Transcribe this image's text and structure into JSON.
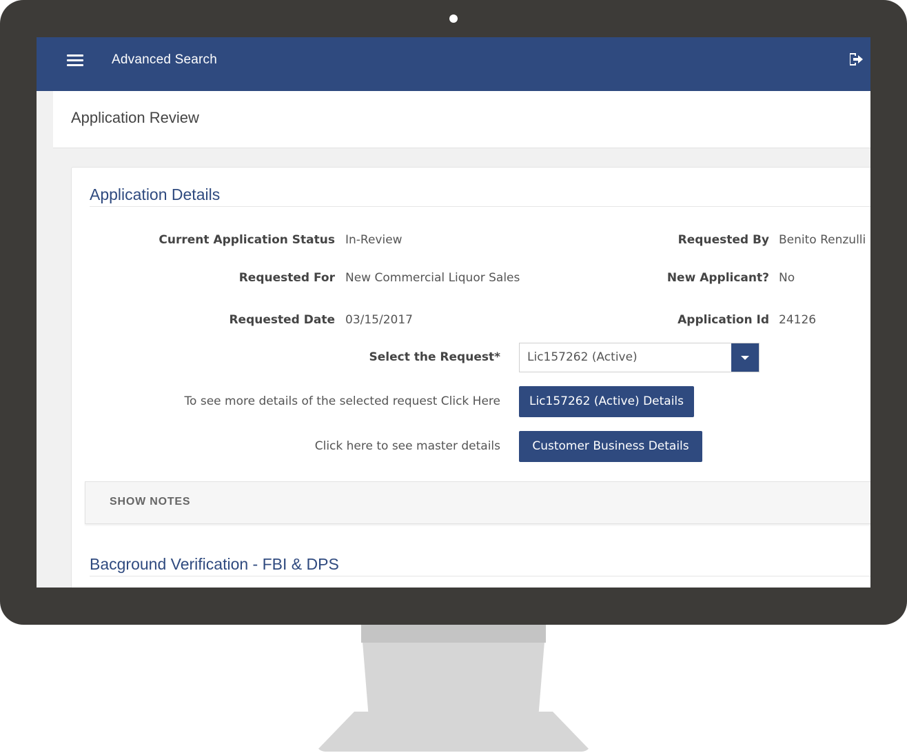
{
  "topbar": {
    "title": "Advanced Search",
    "menu_icon": "hamburger-menu-icon",
    "logout_icon": "logout-icon"
  },
  "page": {
    "title": "Application Review"
  },
  "details": {
    "section_title": "Application Details",
    "current_status_label": "Current Application Status",
    "current_status_value": "In-Review",
    "requested_for_label": "Requested For",
    "requested_for_value": "New Commercial Liquor Sales",
    "requested_date_label": "Requested Date",
    "requested_date_value": "03/15/2017",
    "requested_by_label": "Requested By",
    "requested_by_value": "Benito Renzulli",
    "new_applicant_label": "New Applicant?",
    "new_applicant_value": "No",
    "application_id_label": "Application Id",
    "application_id_value": "24126",
    "select_request_label": "Select the Request*",
    "select_request_value": "Lic157262 (Active)",
    "more_details_hint": "To see more details of the selected request Click Here",
    "more_details_button": "Lic157262 (Active) Details",
    "master_details_hint": "Click here to see master details",
    "master_details_button": "Customer Business Details"
  },
  "notes": {
    "label": "SHOW NOTES"
  },
  "background": {
    "section_title": "Bacground Verification - FBI & DPS"
  },
  "colors": {
    "brand": "#2f4a7f",
    "monitor_frame": "#3d3b38",
    "stand": "#d6d6d6"
  }
}
